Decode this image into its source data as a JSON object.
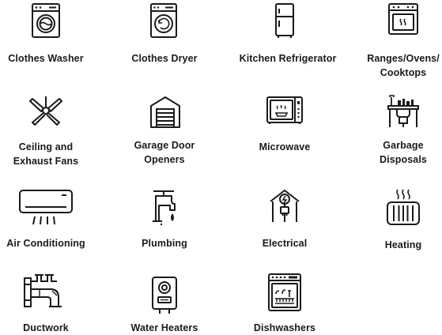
{
  "services": [
    {
      "label": "Clothes Washer",
      "icon": "washing-machine-icon"
    },
    {
      "label": "Clothes Dryer",
      "icon": "clothes-dryer-icon"
    },
    {
      "label": "Kitchen Refrigerator",
      "icon": "refrigerator-icon"
    },
    {
      "label_lines": [
        "Ranges/Ovens/",
        "Cooktops"
      ],
      "icon": "oven-range-icon"
    },
    {
      "label_lines": [
        "Ceiling and",
        "Exhaust Fans"
      ],
      "icon": "ceiling-fan-icon"
    },
    {
      "label_lines": [
        "Garage Door",
        "Openers"
      ],
      "icon": "garage-door-icon"
    },
    {
      "label": "Microwave",
      "icon": "microwave-icon"
    },
    {
      "label_lines": [
        "Garbage",
        "Disposals"
      ],
      "icon": "garbage-disposal-icon"
    },
    {
      "label": "Air Conditioning",
      "icon": "air-conditioner-icon"
    },
    {
      "label": "Plumbing",
      "icon": "faucet-icon"
    },
    {
      "label": "Electrical",
      "icon": "electrical-house-icon"
    },
    {
      "label": "Heating",
      "icon": "radiator-icon"
    },
    {
      "label": "Ductwork",
      "icon": "ductwork-icon"
    },
    {
      "label": "Water Heaters",
      "icon": "water-heater-icon"
    },
    {
      "label": "Dishwashers",
      "icon": "dishwasher-icon"
    }
  ]
}
